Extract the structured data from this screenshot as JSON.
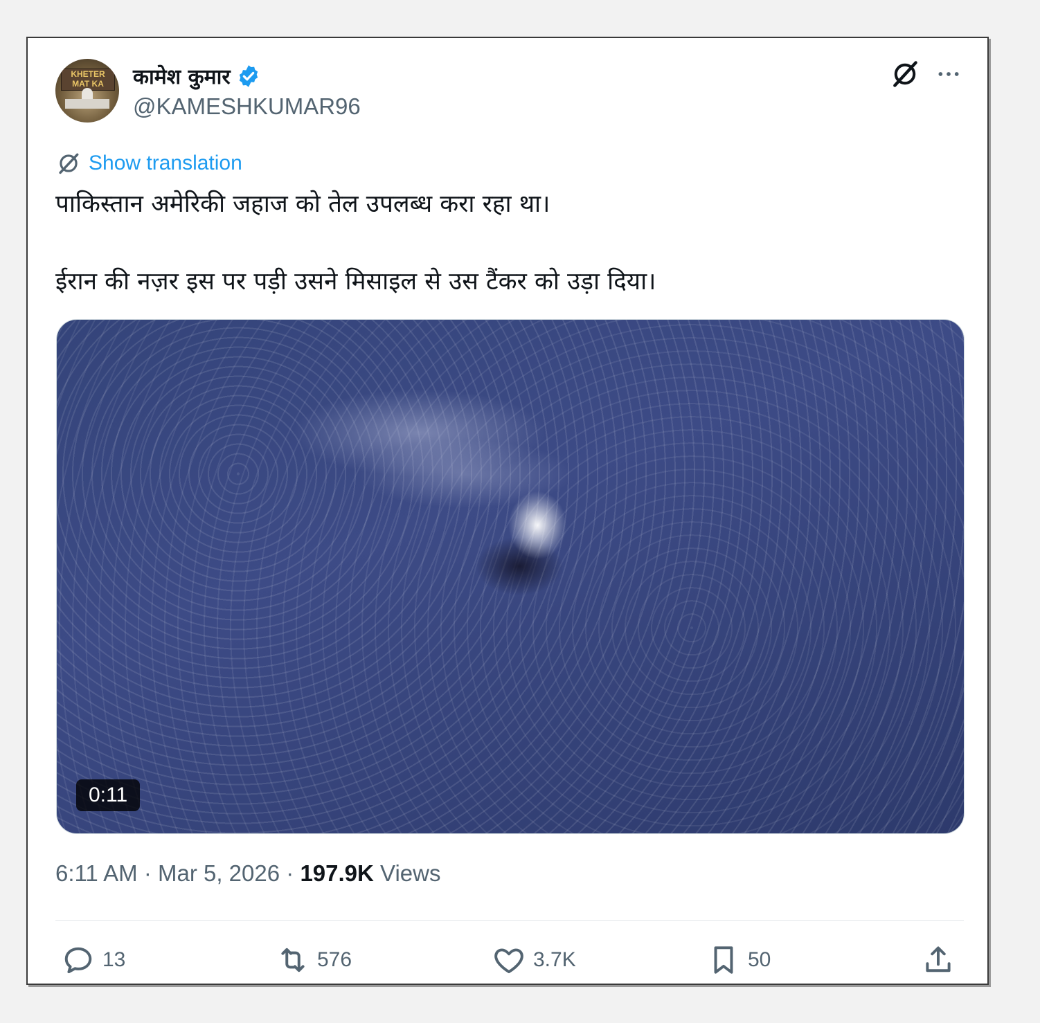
{
  "author": {
    "display_name": "कामेश कुमार",
    "handle": "@KAMESHKUMAR96",
    "avatar_sign_line1": "KHETER",
    "avatar_sign_line2": "MAT KA"
  },
  "translation": {
    "label": "Show translation"
  },
  "tweet": {
    "line1": "पाकिस्तान अमेरिकी जहाज को तेल उपलब्ध करा रहा था।",
    "line2": "ईरान की नज़र इस पर पड़ी उसने मिसाइल से उस टैंकर को उड़ा दिया।"
  },
  "media": {
    "duration": "0:11"
  },
  "meta": {
    "time": "6:11 AM",
    "date": "Mar 5, 2026",
    "views_count": "197.9K",
    "views_label": "Views"
  },
  "actions": {
    "replies": "13",
    "reposts": "576",
    "likes": "3.7K",
    "bookmarks": "50"
  },
  "colors": {
    "accent": "#1d9bf0",
    "text_primary": "#0f1419",
    "text_secondary": "#536471"
  },
  "icons": [
    "verified-badge-icon",
    "grok-icon",
    "more-icon",
    "translate-icon",
    "reply-icon",
    "repost-icon",
    "like-icon",
    "bookmark-icon",
    "share-icon"
  ]
}
